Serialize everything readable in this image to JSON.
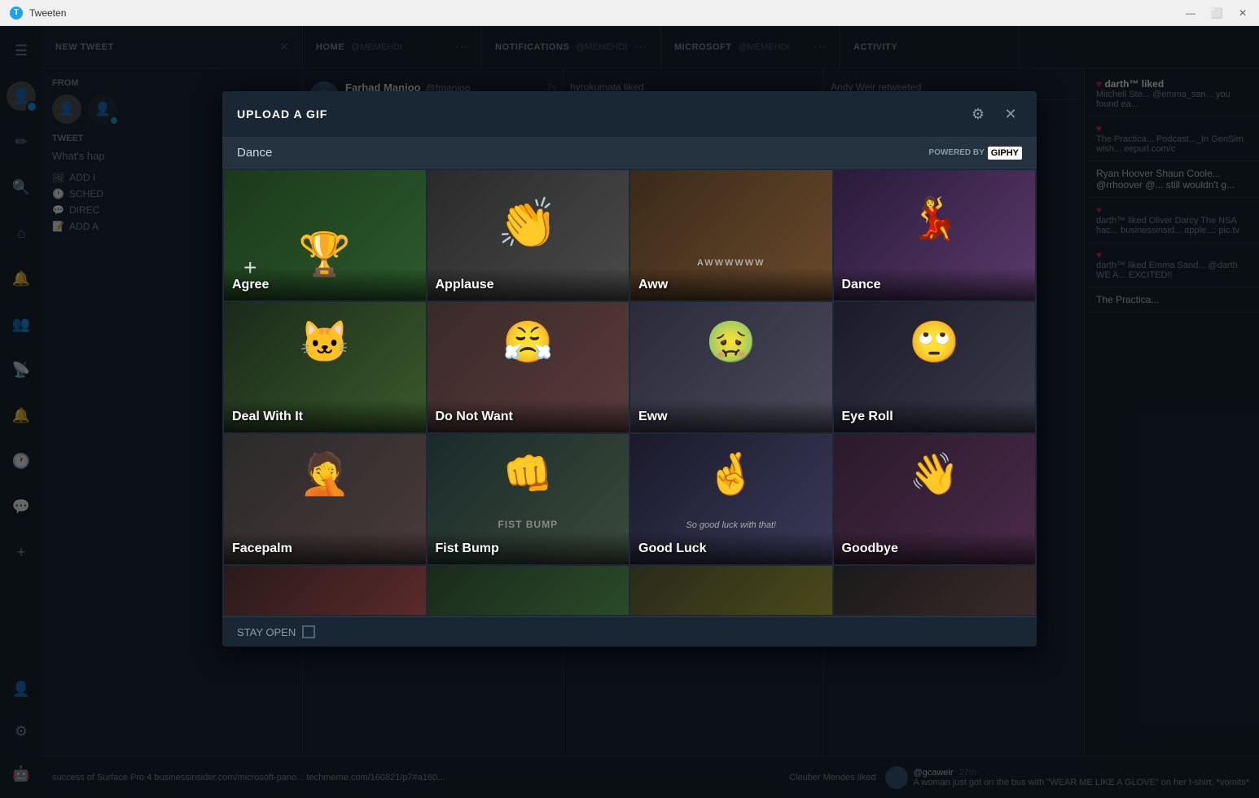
{
  "window": {
    "title": "Tweeten",
    "controls": [
      "minimize",
      "maximize",
      "close"
    ]
  },
  "header": {
    "tabs": [
      {
        "id": "new-tweet",
        "label": "NEW TWEET",
        "closable": true
      },
      {
        "id": "home",
        "label": "HOME",
        "handle": "@MEMEHDI",
        "more": true
      },
      {
        "id": "notifications",
        "label": "NOTIFICATIONS",
        "handle": "@MEMEHDI",
        "more": true
      },
      {
        "id": "microsoft",
        "label": "MICROSOFT",
        "handle": "@MEMEHDI",
        "more": true
      },
      {
        "id": "activity",
        "label": "ACTIVITY",
        "handle": ""
      }
    ]
  },
  "sidebar": {
    "icons": [
      {
        "id": "menu",
        "symbol": "☰"
      },
      {
        "id": "edit",
        "symbol": "✏"
      },
      {
        "id": "search",
        "symbol": "🔍"
      },
      {
        "id": "home",
        "symbol": "⌂"
      },
      {
        "id": "notifications",
        "symbol": "🔔"
      },
      {
        "id": "users",
        "symbol": "👥"
      },
      {
        "id": "wifi",
        "symbol": "📡"
      },
      {
        "id": "bell2",
        "symbol": "🔔"
      },
      {
        "id": "clock",
        "symbol": "🕐"
      },
      {
        "id": "message",
        "symbol": "💬"
      },
      {
        "id": "add",
        "symbol": "+"
      }
    ],
    "bottom_icons": [
      {
        "id": "profile",
        "symbol": "👤"
      },
      {
        "id": "settings",
        "symbol": "⚙"
      },
      {
        "id": "bot",
        "symbol": "🤖"
      }
    ]
  },
  "new_tweet": {
    "from_label": "FROM",
    "tweet_label": "TWEET",
    "what_hap_placeholder": "What's hap",
    "add_image_label": "ADD I",
    "schedule_label": "SCHED",
    "direct_label": "DIREC",
    "add_alt_label": "ADD A"
  },
  "modal": {
    "title": "UPLOAD A GIF",
    "search_query": "Dance",
    "giphy_label": "POWERED BY",
    "giphy_brand": "GIPHY",
    "settings_icon": "⚙",
    "close_icon": "✕",
    "stay_open_label": "STAY OPEN",
    "gif_categories": [
      {
        "id": "agree",
        "label": "Agree",
        "sublabel": "",
        "style": "agree",
        "has_trophy": true
      },
      {
        "id": "applause",
        "label": "Applause",
        "sublabel": "",
        "style": "applause",
        "has_trophy": false
      },
      {
        "id": "aww",
        "label": "Aww",
        "sublabel": "AWWWWWW",
        "style": "aww",
        "has_trophy": false
      },
      {
        "id": "dance",
        "label": "Dance",
        "sublabel": "",
        "style": "dance",
        "has_trophy": false
      },
      {
        "id": "dealwith",
        "label": "Deal With It",
        "sublabel": "",
        "style": "dealwith",
        "has_trophy": false
      },
      {
        "id": "donotwant",
        "label": "Do Not Want",
        "sublabel": "",
        "style": "donotwant",
        "has_trophy": false
      },
      {
        "id": "eww",
        "label": "Eww",
        "sublabel": "",
        "style": "eww",
        "has_trophy": false
      },
      {
        "id": "eyeroll",
        "label": "Eye Roll",
        "sublabel": "",
        "style": "eyeroll",
        "has_trophy": false
      },
      {
        "id": "facepalm",
        "label": "Facepalm",
        "sublabel": "",
        "style": "facepalm",
        "has_trophy": false
      },
      {
        "id": "fistbump",
        "label": "Fist Bump",
        "sublabel": "FIST BUMP",
        "style": "fistbump",
        "has_trophy": false
      },
      {
        "id": "goodluck",
        "label": "Good Luck",
        "sublabel": "So good luck with that!",
        "style": "goodluck",
        "has_trophy": false
      },
      {
        "id": "goodbye",
        "label": "Goodbye",
        "sublabel": "",
        "style": "goodbye",
        "has_trophy": false
      }
    ],
    "partial_row": [
      {
        "id": "partial-1",
        "style": "partial-1",
        "label": ""
      },
      {
        "id": "partial-2",
        "style": "partial-2",
        "label": ""
      },
      {
        "id": "partial-3",
        "style": "partial-3",
        "label": ""
      },
      {
        "id": "partial-4",
        "style": "partial-4",
        "label": ""
      }
    ]
  },
  "activity_sidebar": {
    "items": [
      {
        "user": "darth™ liked",
        "snippet": "Mitchell Ste... @emma_san... you found ea...",
        "has_heart": true
      },
      {
        "user": "The Practica...",
        "snippet": "Podcast...__In... Podcast...__In... GenSim wish... eepurl.com/c...",
        "has_heart": true
      },
      {
        "user": "Ryan Hoover Shaun Coole...",
        "snippet": "@rrhoover @... still wouldn't g...",
        "has_heart": false
      },
      {
        "user": "darth™ liked Oliver Darcy",
        "snippet": "The NSA hac... to fight the FE... businessinsid... apple...: pic.tv...",
        "has_heart": true
      },
      {
        "user": "darth™ liked Emma Sand...",
        "snippet": "@darth WE A... EXCITED!!",
        "has_heart": true
      },
      {
        "user": "The Practica...",
        "snippet": "",
        "has_heart": false
      }
    ]
  },
  "bottom_bar": {
    "notification_text": "success of Surface Pro 4 businessinsider.com/microsoft-pano... techmeme.com/160821/p7#a160...",
    "andy_weir_handle": "@gcaweir",
    "andy_weir_time": "27m",
    "andy_weir_text": "A woman just got on the bus with \"WEAR ME LIKE A GLOVE\" on her t-shirt. *vomits*",
    "cleuber_liked": "Cleuber Mendes liked"
  }
}
